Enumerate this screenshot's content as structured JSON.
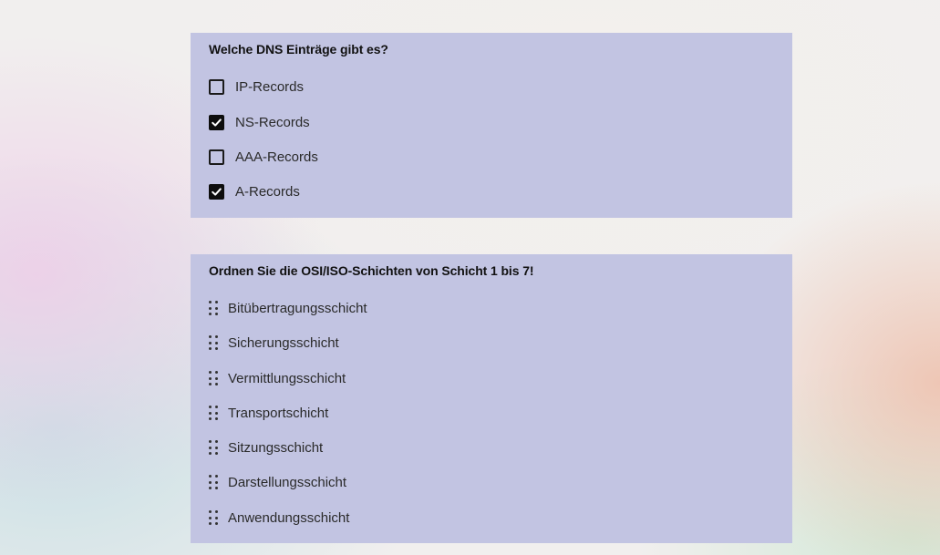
{
  "question1": {
    "title": "Welche DNS Einträge gibt es?",
    "options": [
      {
        "label": "IP-Records",
        "checked": false
      },
      {
        "label": "NS-Records",
        "checked": true
      },
      {
        "label": "AAA-Records",
        "checked": false
      },
      {
        "label": "A-Records",
        "checked": true
      }
    ]
  },
  "question2": {
    "title": "Ordnen Sie die OSI/ISO-Schichten von Schicht 1 bis 7!",
    "items": [
      {
        "label": "Bitübertragungsschicht"
      },
      {
        "label": "Sicherungsschicht"
      },
      {
        "label": "Vermittlungsschicht"
      },
      {
        "label": "Transportschicht"
      },
      {
        "label": "Sitzungsschicht"
      },
      {
        "label": "Darstellungsschicht"
      },
      {
        "label": "Anwendungsschicht"
      }
    ]
  },
  "icons": {
    "checkbox_check": "check-icon",
    "drag_handle": "drag-handle-icon"
  },
  "colors": {
    "card_background": "#c2c4e2",
    "checkbox_checked": "#0d0d0d",
    "text": "#2a2a2a"
  }
}
